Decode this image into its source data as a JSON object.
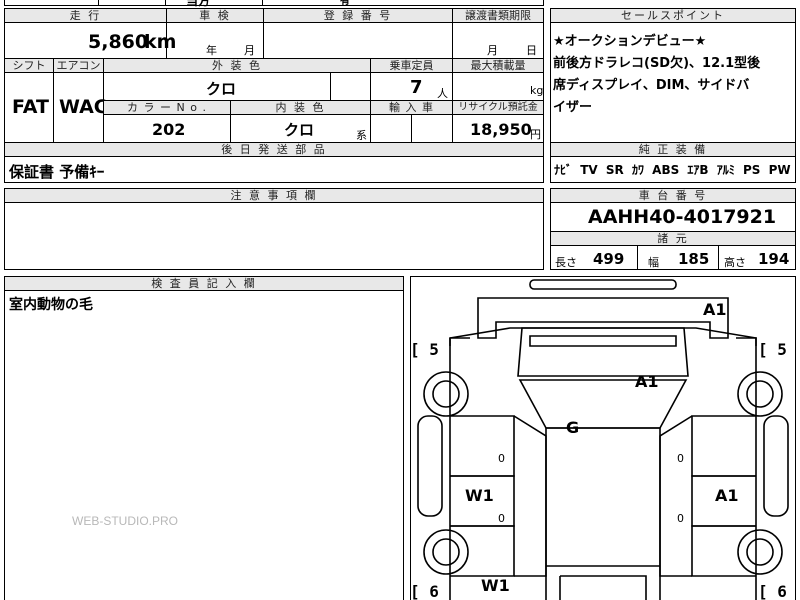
{
  "top_partial": [
    "当方",
    "有"
  ],
  "header": {
    "mileage_label": "走 行",
    "inspection_label": "車 検",
    "registration_label": "登 録 番 号",
    "transfer_deadline_label": "譲渡書類期限",
    "sales_point_label": "セールスポイント"
  },
  "mileage": {
    "value": "5,860",
    "unit": "km"
  },
  "inspection": {
    "year_label": "年",
    "month_label": "月"
  },
  "transfer": {
    "month_label": "月",
    "day_label": "日"
  },
  "sales_point_text": [
    "★オークションデビュー★",
    "前後方ドラレコ(SD欠)、12.1型後",
    "席ディスプレイ、DIM、サイドバ",
    "イザー"
  ],
  "row2_labels": {
    "shift": "シフト",
    "aircon": "エアコン",
    "exterior_color": "外 装 色",
    "capacity": "乗車定員",
    "max_load": "最大積載量"
  },
  "shift_value": "FAT",
  "aircon_value": "WAC",
  "exterior_color_value": "クロ",
  "capacity": {
    "value": "7",
    "unit": "人"
  },
  "max_load_unit": "kg",
  "row3_labels": {
    "color_no": "カ ラ ー N o .",
    "interior_color": "内 装 色",
    "import": "輸 入 車",
    "recycle": "リサイクル預託金"
  },
  "color_no_value": "202",
  "interior_color": {
    "value": "クロ",
    "suffix": "系"
  },
  "recycle": {
    "value": "18,950",
    "unit": "円"
  },
  "later_parts_label": "後 日 発 送 部 品",
  "later_parts_value": "保証書  予備ｷｰ",
  "factory_equipment_label": "純 正 装 備",
  "factory_equipment": [
    "ﾅﾋﾞ",
    "TV",
    "SR",
    "ｶﾜ",
    "ABS",
    "ｴｱB",
    "ｱﾙﾐ",
    "PS",
    "PW"
  ],
  "notes_label": "注 意 事 項 欄",
  "chassis_label": "車 台 番 号",
  "chassis_number": "AAHH40-4017921",
  "specs_label": "諸 元",
  "specs": {
    "length_label": "長さ",
    "length": "499",
    "width_label": "幅",
    "width": "185",
    "height_label": "高さ",
    "height": "194"
  },
  "inspector_label": "検 査 員 記 入 欄",
  "inspector_note": "室内動物の毛",
  "watermark": "WEB-STUDIO.PRO",
  "diagram_labels": {
    "front_bumper": "A1",
    "hood": "A1",
    "windshield": "G",
    "left_front_door": "W1",
    "right_front_door": "A1",
    "left_rear": "W1",
    "bracket_tl": "[ 5",
    "bracket_tr": "[ 5",
    "bracket_bl": "[ 6",
    "bracket_br": "[ 6",
    "zero": "0"
  }
}
